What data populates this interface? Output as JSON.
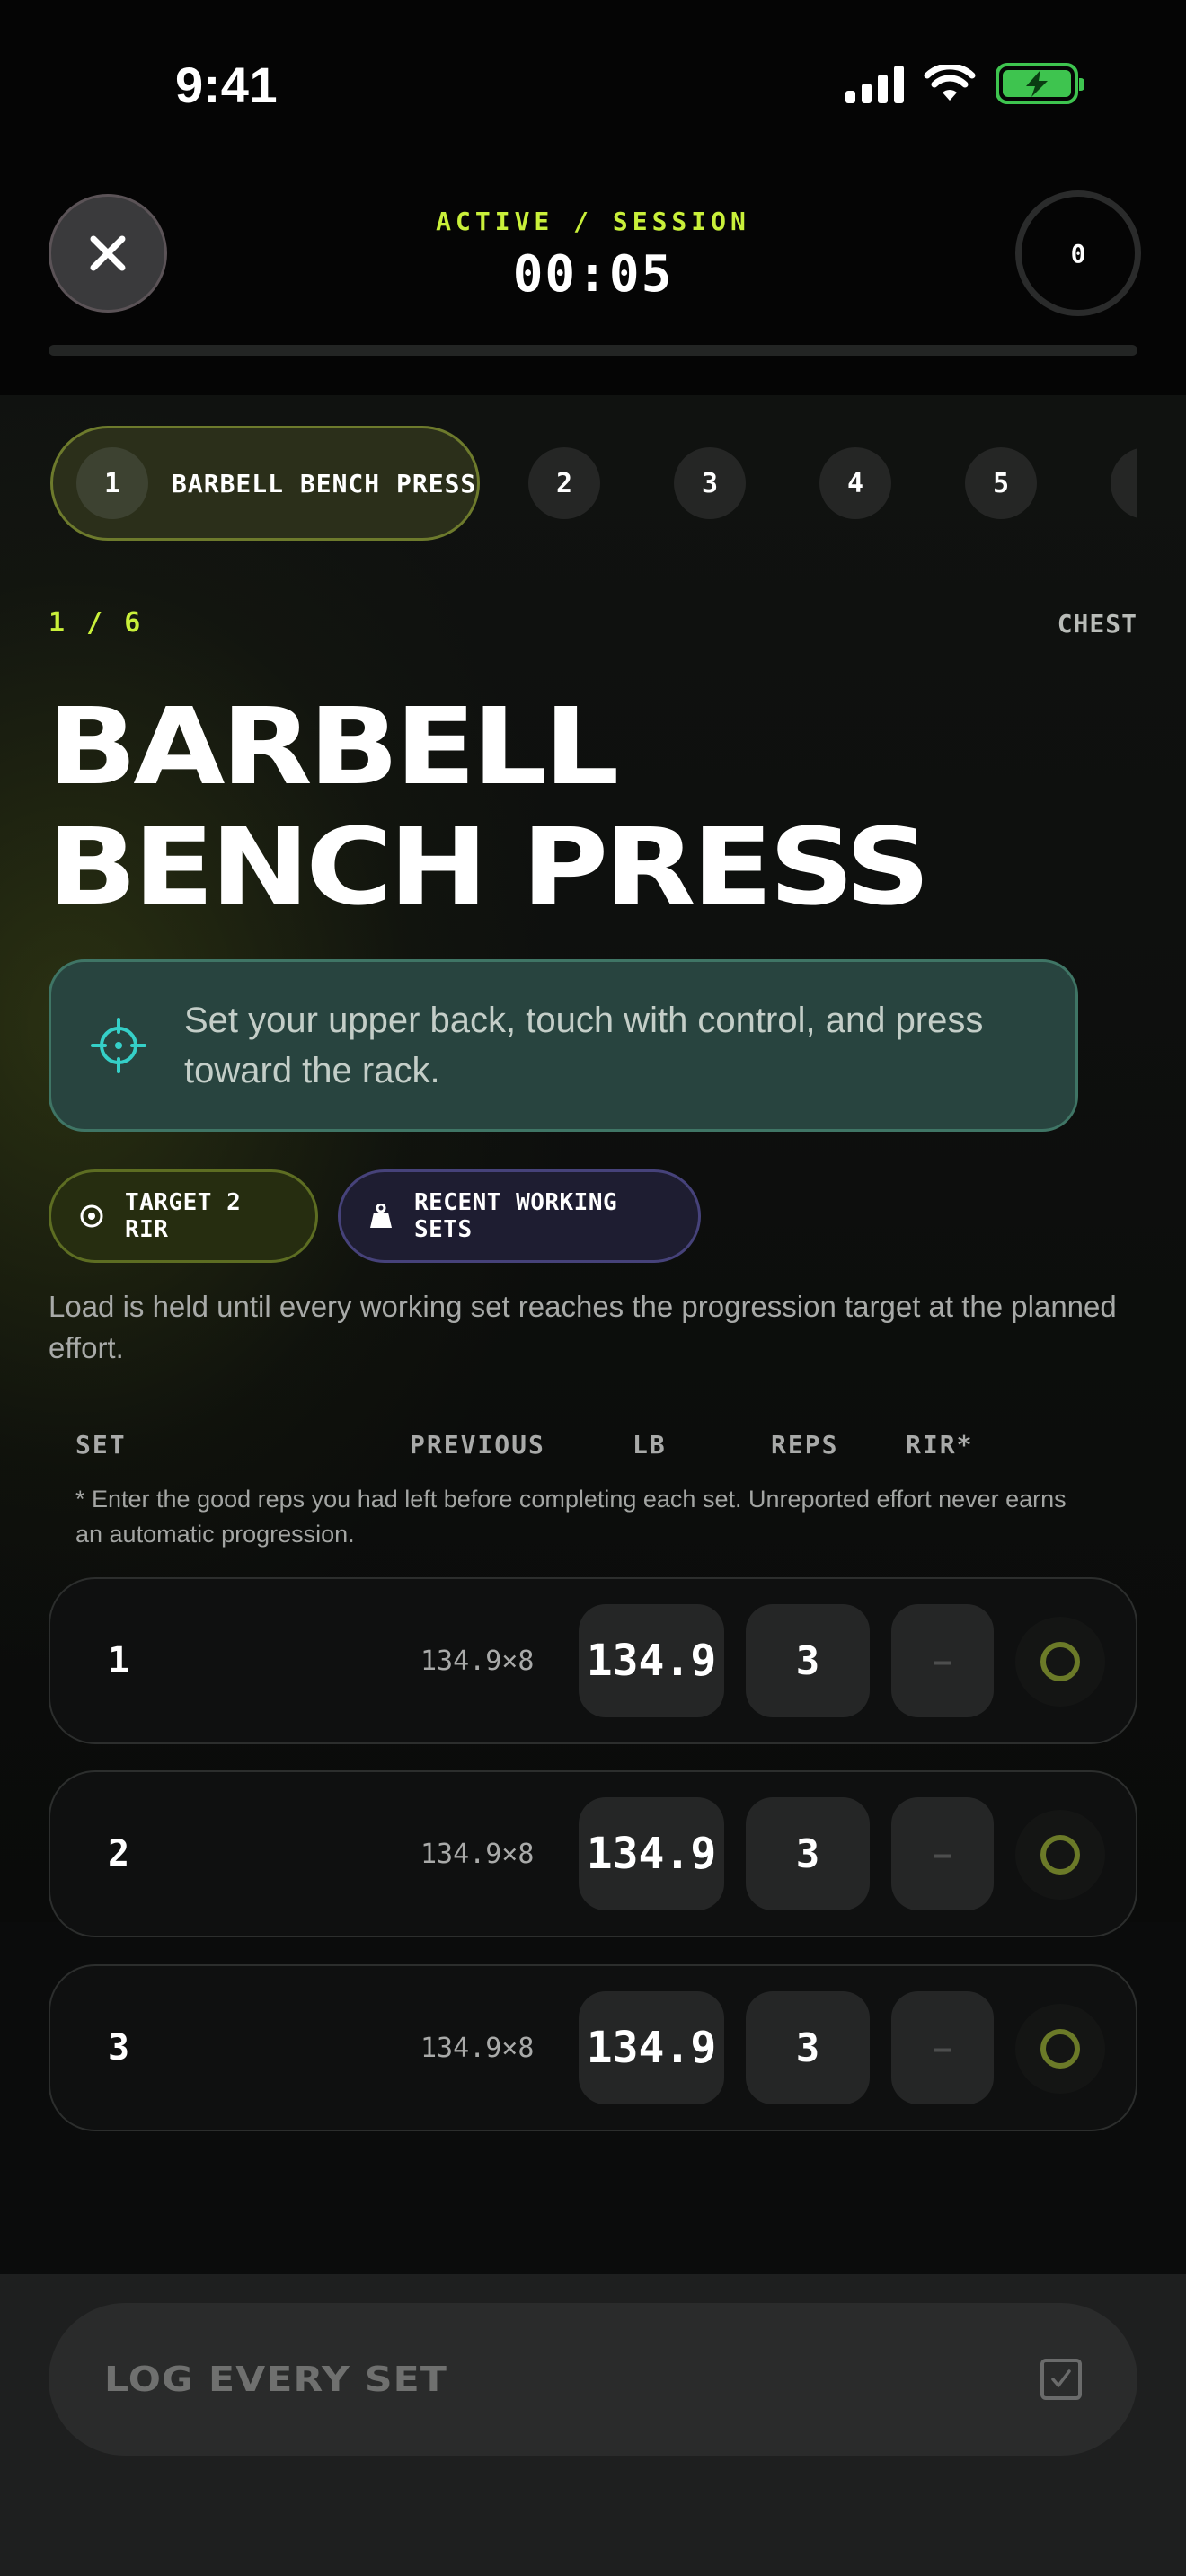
{
  "status_bar": {
    "time": "9:41",
    "icons": [
      "cellular-signal-icon",
      "wifi-icon",
      "battery-charging-icon"
    ]
  },
  "header": {
    "close_icon": "close-icon",
    "label": "ACTIVE / SESSION",
    "timer": "00:05",
    "counter": "0"
  },
  "exercise_tabs": [
    {
      "number": "1",
      "label": "BARBELL BENCH PRESS",
      "active": true
    },
    {
      "number": "2"
    },
    {
      "number": "3"
    },
    {
      "number": "4"
    },
    {
      "number": "5"
    }
  ],
  "exercise": {
    "position": "1 / 6",
    "muscle": "CHEST",
    "title_line1": "BARBELL",
    "title_line2": "BENCH PRESS",
    "cue": "Set your upper back, touch with control, and press toward the rack.",
    "cue_icon": "crosshair-icon"
  },
  "chips": {
    "target": "TARGET 2 RIR",
    "recent": "RECENT WORKING SETS"
  },
  "note": "Load is held until every working set reaches the progression target at the planned effort.",
  "table": {
    "headers": {
      "set": "SET",
      "previous": "PREVIOUS",
      "lb": "LB",
      "reps": "REPS",
      "rir": "RIR*"
    },
    "footnote": "* Enter the good reps you had left before completing each set. Unreported effort never earns an automatic progression.",
    "rows": [
      {
        "set": "1",
        "previous": "134.9×8",
        "lb": "134.9",
        "reps": "3",
        "rir": "–"
      },
      {
        "set": "2",
        "previous": "134.9×8",
        "lb": "134.9",
        "reps": "3",
        "rir": "–"
      },
      {
        "set": "3",
        "previous": "134.9×8",
        "lb": "134.9",
        "reps": "3",
        "rir": "–"
      }
    ]
  },
  "footer": {
    "log_button": "LOG EVERY SET"
  },
  "colors": {
    "accent": "#c9f03a",
    "cue_bg": "#28443f",
    "battery": "#3ec44f"
  }
}
